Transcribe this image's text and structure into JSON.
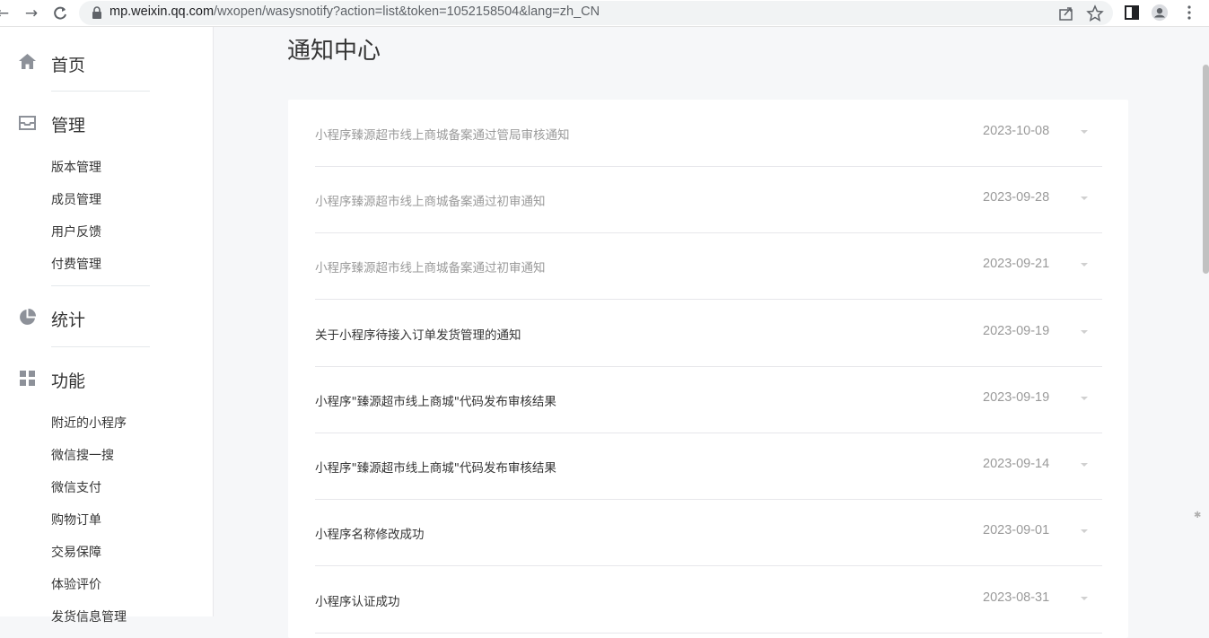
{
  "browser": {
    "url_host": "mp.weixin.qq.com",
    "url_path": "/wxopen/wasysnotify?action=list&token=1052158504&lang=zh_CN"
  },
  "sidebar": {
    "home": "首页",
    "manage": "管理",
    "manage_items": [
      "版本管理",
      "成员管理",
      "用户反馈",
      "付费管理"
    ],
    "stats": "统计",
    "features": "功能",
    "feature_items": [
      "附近的小程序",
      "微信搜一搜",
      "微信支付",
      "购物订单",
      "交易保障",
      "体验评价",
      "发货信息管理"
    ]
  },
  "main": {
    "title": "通知中心",
    "notifications": [
      {
        "title": "小程序臻源超市线上商城备案通过管局审核通知",
        "date": "2023-10-08",
        "read": true
      },
      {
        "title": "小程序臻源超市线上商城备案通过初审通知",
        "date": "2023-09-28",
        "read": true
      },
      {
        "title": "小程序臻源超市线上商城备案通过初审通知",
        "date": "2023-09-21",
        "read": true
      },
      {
        "title": "关于小程序待接入订单发货管理的通知",
        "date": "2023-09-19",
        "read": false
      },
      {
        "title": "小程序\"臻源超市线上商城\"代码发布审核结果",
        "date": "2023-09-19",
        "read": false
      },
      {
        "title": "小程序\"臻源超市线上商城\"代码发布审核结果",
        "date": "2023-09-14",
        "read": false
      },
      {
        "title": "小程序名称修改成功",
        "date": "2023-09-01",
        "read": false
      },
      {
        "title": "小程序认证成功",
        "date": "2023-08-31",
        "read": false
      }
    ]
  },
  "icons": {
    "home": "home-icon",
    "manage": "inbox-icon",
    "stats": "pie-chart-icon",
    "features": "grid-icon"
  }
}
